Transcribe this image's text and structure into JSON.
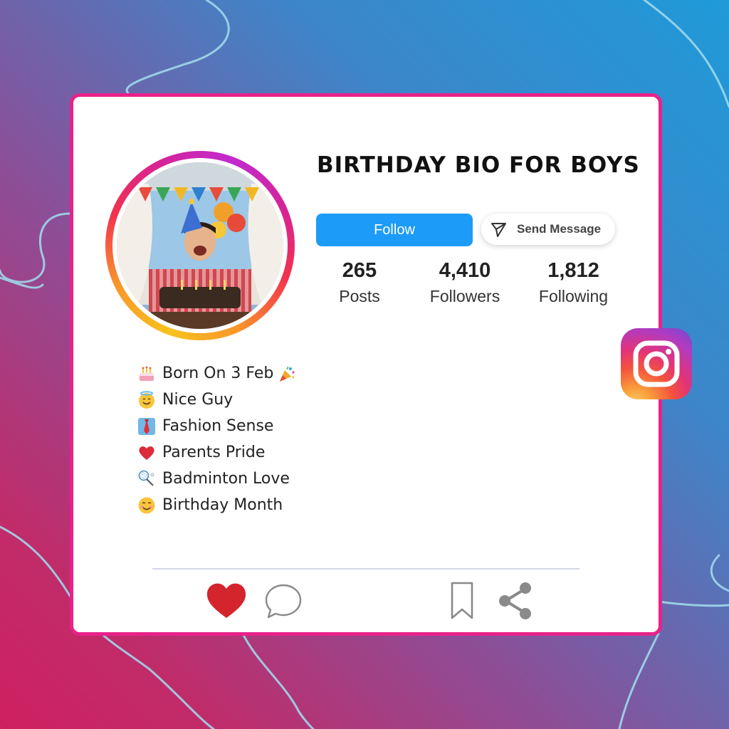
{
  "profile": {
    "title": "BIRTHDAY BIO FOR BOYS",
    "follow_label": "Follow",
    "message_label": "Send Message"
  },
  "stats": [
    {
      "value": "265",
      "label": "Posts"
    },
    {
      "value": "4,410",
      "label": "Followers"
    },
    {
      "value": "1,812",
      "label": "Following"
    }
  ],
  "bio": [
    {
      "icon": "birthday-cake-icon",
      "text": "Born On 3 Feb"
    },
    {
      "icon": "smiling-halo-icon",
      "text": "Nice Guy"
    },
    {
      "icon": "necktie-icon",
      "text": "Fashion Sense"
    },
    {
      "icon": "red-heart-icon",
      "text": "Parents Pride"
    },
    {
      "icon": "badminton-icon",
      "text": "Badminton Love"
    },
    {
      "icon": "blush-smile-icon",
      "text": "Birthday Month"
    }
  ],
  "actions": {
    "like": "heart-icon",
    "comment": "comment-icon",
    "save": "bookmark-icon",
    "share": "share-icon"
  },
  "colors": {
    "accent_border": "#e8228a",
    "follow_blue": "#1d9bf8",
    "heart_red": "#d4242c"
  }
}
